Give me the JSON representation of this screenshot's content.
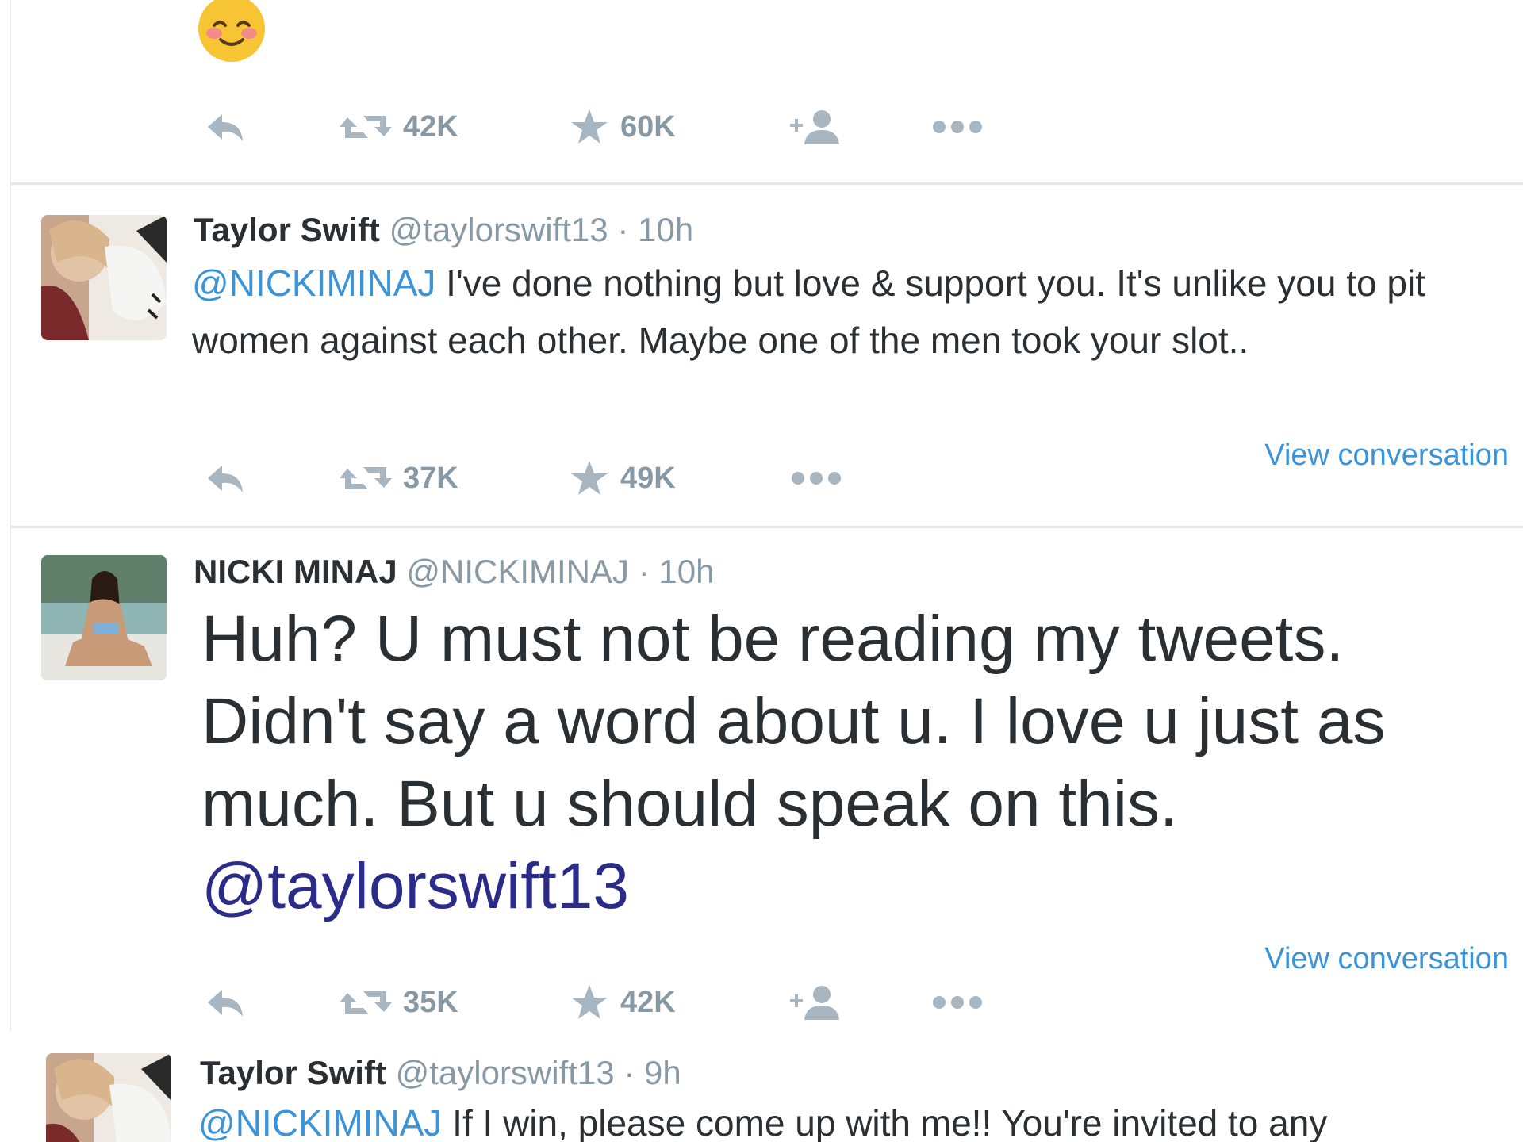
{
  "colors": {
    "text": "#292f33",
    "muted": "#8899a6",
    "link": "#3b94d9",
    "divider": "#e1e8ed"
  },
  "tweets": [
    {
      "emoji": "smiling-face-icon",
      "actions": {
        "reply_icon": "reply-icon",
        "retweet_count": "42K",
        "favorite_count": "60K",
        "follow_icon": "add-user-icon",
        "more_icon": "more-icon"
      }
    },
    {
      "name": "Taylor Swift",
      "handle": "@taylorswift13",
      "separator": "·",
      "time": "10h",
      "mention": "@NICKIMINAJ",
      "text": " I've done nothing but love & support you. It's unlike you to pit women against each other. Maybe one of the men took your slot..",
      "actions": {
        "retweet_count": "37K",
        "favorite_count": "49K"
      },
      "view_conversation": "View conversation"
    },
    {
      "name": "NICKI MINAJ",
      "handle": "@NICKIMINAJ",
      "separator": "·",
      "time": "10h",
      "text": "Huh? U must not be reading my tweets. Didn't say a word about u. I love u just as much. But u should speak on this.",
      "mention": "@taylorswift13",
      "actions": {
        "retweet_count": "35K",
        "favorite_count": "42K"
      },
      "view_conversation": "View conversation"
    },
    {
      "name": "Taylor Swift",
      "handle": "@taylorswift13",
      "separator": "·",
      "time": "9h",
      "mention": "@NICKIMINAJ",
      "text": " If I win, please come up with me!! You're invited to any"
    }
  ]
}
